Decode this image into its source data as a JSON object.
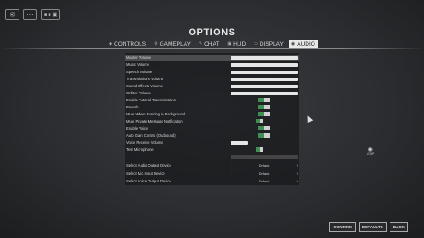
{
  "app": {
    "title": "OPTIONS"
  },
  "topbar": {
    "icons": [
      {
        "name": "chat-bubble-icon",
        "glyph": "✉"
      },
      {
        "name": "menu-icon",
        "glyph": "⋯"
      }
    ],
    "group": {
      "a": "■ ■",
      "b": "▣"
    }
  },
  "tabs": [
    {
      "label": "CONTROLS",
      "icon": "controls-icon",
      "glyph": "◆",
      "active": false
    },
    {
      "label": "GAMEPLAY",
      "icon": "gameplay-icon",
      "glyph": "⚙",
      "active": false
    },
    {
      "label": "CHAT",
      "icon": "chat-icon",
      "glyph": "✎",
      "active": false
    },
    {
      "label": "HUD",
      "icon": "hud-icon",
      "glyph": "▣",
      "active": false
    },
    {
      "label": "DISPLAY",
      "icon": "display-icon",
      "glyph": "▭",
      "active": false
    },
    {
      "label": "AUDIO",
      "icon": "audio-icon",
      "glyph": "◉",
      "active": true
    }
  ],
  "audio_settings": [
    {
      "label": "Master Volume",
      "control": "slider",
      "selected": true
    },
    {
      "label": "Music Volume",
      "control": "slider"
    },
    {
      "label": "Speech Volume",
      "control": "slider"
    },
    {
      "label": "Transmissions Volume",
      "control": "slider"
    },
    {
      "label": "Sound Effects Volume",
      "control": "slider"
    },
    {
      "label": "Orbiter Volume",
      "control": "slider"
    },
    {
      "label": "Enable Tutorial Transmissions",
      "control": "toggle"
    },
    {
      "label": "Reverb",
      "control": "toggle"
    },
    {
      "label": "Mute When Running in Background",
      "control": "toggle"
    },
    {
      "label": "Mute Private Message Notification",
      "control": "toggle-small"
    },
    {
      "label": "Enable Voice",
      "control": "toggle"
    },
    {
      "label": "Auto Gain Control (Outbound)",
      "control": "toggle"
    },
    {
      "label": "Voice Receive Volume",
      "control": "slider-short"
    },
    {
      "label": "Test Microphone",
      "control": "toggle-small"
    }
  ],
  "device_settings": [
    {
      "label": "Select Audio Output Device",
      "value": "Default"
    },
    {
      "label": "Select Mic Input Device",
      "value": "Default"
    },
    {
      "label": "Select Voice Output Device",
      "value": "Default"
    }
  ],
  "voip": {
    "label": "VOIP"
  },
  "buttons": {
    "confirm": "CONFIRM",
    "defaults": "DEFAULTS",
    "back": "BACK"
  }
}
